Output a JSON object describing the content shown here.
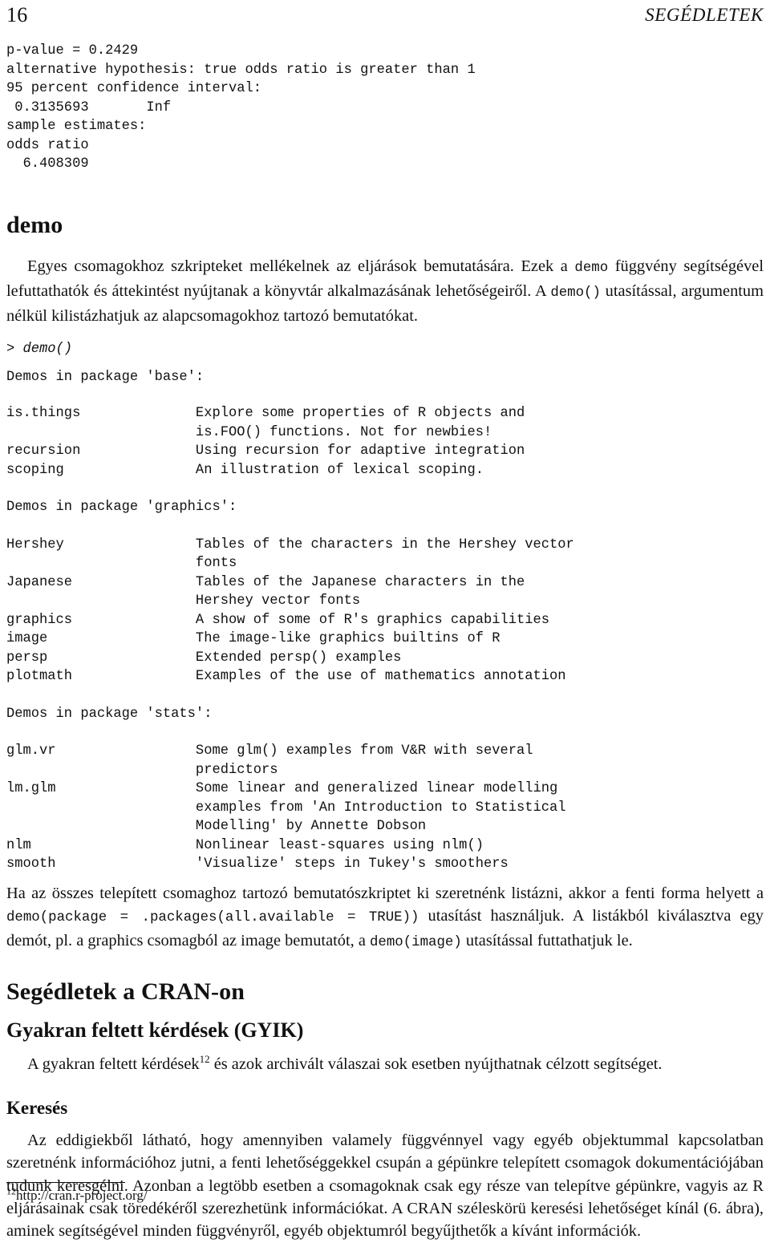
{
  "page": {
    "folio": "16",
    "running_head": "SEGÉDLETEK"
  },
  "output_block_1": "p-value = 0.2429\nalternative hypothesis: true odds ratio is greater than 1\n95 percent confidence interval:\n 0.3135693       Inf\nsample estimates:\nodds ratio\n  6.408309",
  "section_demo": {
    "heading": "demo",
    "paragraph_1_part_1": "Egyes csomagokhoz szkripteket mellékelnek az eljárások bemutatására. Ezek a ",
    "code_demo": "demo",
    "paragraph_1_part_2": " függvény segítségével lefuttathatók és áttekintést nyújtanak a könyvtár alkalmazásának lehetőségeiről. A ",
    "code_demo_call": "demo()",
    "paragraph_1_part_3": " utasítással, argumentum nélkül kilistázhatjuk az alapcsomagokhoz tartozó bemutatókat.",
    "prompt_line": "> demo()",
    "base_header": "Demos in package 'base':",
    "base_demos_block": "is.things              Explore some properties of R objects and\n                       is.FOO() functions. Not for newbies!\nrecursion              Using recursion for adaptive integration\nscoping                An illustration of lexical scoping.",
    "graphics_header": "Demos in package 'graphics':",
    "graphics_demos_block": "Hershey                Tables of the characters in the Hershey vector\n                       fonts\nJapanese               Tables of the Japanese characters in the\n                       Hershey vector fonts\ngraphics               A show of some of R's graphics capabilities\nimage                  The image-like graphics builtins of R\npersp                  Extended persp() examples\nplotmath               Examples of the use of mathematics annotation",
    "stats_header": "Demos in package 'stats':",
    "stats_demos_block": "glm.vr                 Some glm() examples from V&R with several\n                       predictors\nlm.glm                 Some linear and generalized linear modelling\n                       examples from 'An Introduction to Statistical\n                       Modelling' by Annette Dobson\nnlm                    Nonlinear least-squares using nlm()\nsmooth                 'Visualize' steps in Tukey's smoothers",
    "paragraph_2_part_1": "Ha az összes telepített csomaghoz tartozó bemutatószkriptet ki szeretnénk listázni, akkor a fenti forma helyett a ",
    "code_demo_all": "demo(package = .packages(all.available = TRUE))",
    "paragraph_2_part_2": " utasítást használjuk. A listákból kiválasztva egy demót, pl. a graphics csomagból az image bemutatót, a ",
    "code_demo_image": "demo(image)",
    "paragraph_2_part_3": " utasítással futtathatjuk le."
  },
  "section_cran": {
    "heading": "Segédletek a CRAN-on",
    "sub_faq": {
      "heading": "Gyakran feltett kérdések (GYIK)",
      "paragraph_part_1": "A gyakran feltett kérdések",
      "footnote_marker": "12",
      "paragraph_part_2": " és azok archivált válaszai sok esetben nyújthatnak célzott segítséget."
    },
    "sub_search": {
      "heading": "Keresés",
      "paragraph": "Az eddigiekből látható, hogy amennyiben valamely függvénnyel vagy egyéb objektummal kapcsolatban szeretnénk információhoz jutni, a fenti lehetőséggekkel csupán a gépünkre telepített csomagok dokumentációjában tudunk keresgélni. Azonban a legtöbb esetben a csomagoknak csak egy része van telepítve gépünkre, vagyis az R eljárásainak csak töredékéről szerezhetünk információkat. A CRAN széleskörü keresési lehetőséget kínál (6. ábra), aminek segítségével minden függvényről, egyéb objektumról begyűjthetők a kívánt információk."
    }
  },
  "footnote": {
    "marker": "12",
    "text": "http://cran.r-project.org/"
  }
}
